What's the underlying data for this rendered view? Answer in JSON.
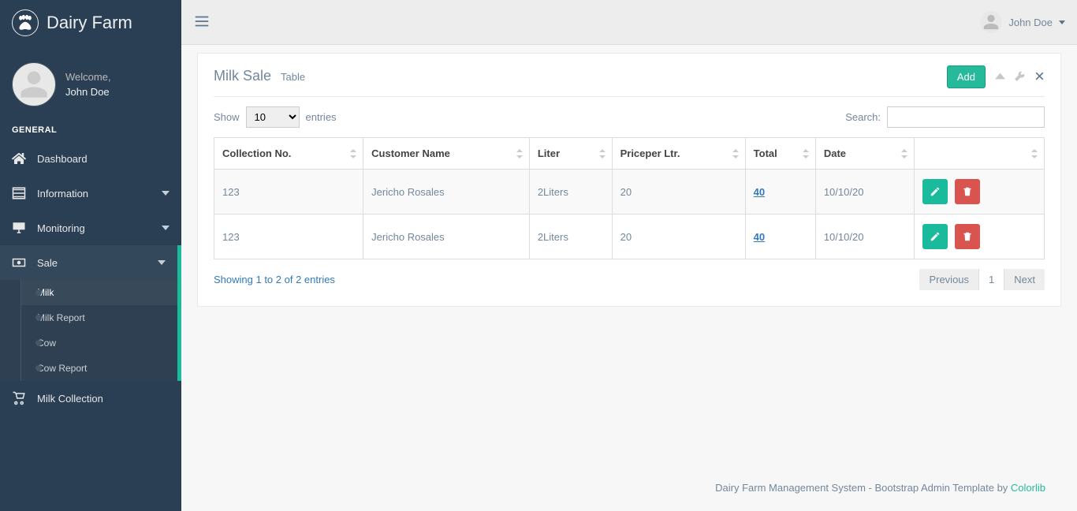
{
  "brand": {
    "title": "Dairy Farm"
  },
  "profile": {
    "welcome": "Welcome,",
    "name": "John Doe"
  },
  "sidebar": {
    "section": "GENERAL",
    "items": [
      {
        "label": "Dashboard"
      },
      {
        "label": "Information"
      },
      {
        "label": "Monitoring"
      },
      {
        "label": "Sale"
      },
      {
        "label": "Milk Collection"
      }
    ],
    "sale_sub": [
      {
        "label": "Milk"
      },
      {
        "label": "Milk Report"
      },
      {
        "label": "Cow"
      },
      {
        "label": "Cow Report"
      }
    ]
  },
  "topbar": {
    "user": "John Doe"
  },
  "panel": {
    "title": "Milk Sale",
    "subtitle": "Table",
    "add_label": "Add"
  },
  "datatable": {
    "show_label": "Show",
    "entries_label": "entries",
    "length_value": "10",
    "search_label": "Search:",
    "columns": [
      "Collection No.",
      "Customer Name",
      "Liter",
      "Priceper Ltr.",
      "Total",
      "Date",
      ""
    ],
    "rows": [
      {
        "collection_no": "123",
        "customer": "Jericho Rosales",
        "liter": "2Liters",
        "price": "20",
        "total": "40",
        "date": "10/10/20"
      },
      {
        "collection_no": "123",
        "customer": "Jericho Rosales",
        "liter": "2Liters",
        "price": "20",
        "total": "40",
        "date": "10/10/20"
      }
    ],
    "info": "Showing 1 to 2 of 2 entries",
    "pager": {
      "prev": "Previous",
      "page": "1",
      "next": "Next"
    }
  },
  "footer": {
    "text": "Dairy Farm Management System - Bootstrap Admin Template by ",
    "link": "Colorlib"
  }
}
